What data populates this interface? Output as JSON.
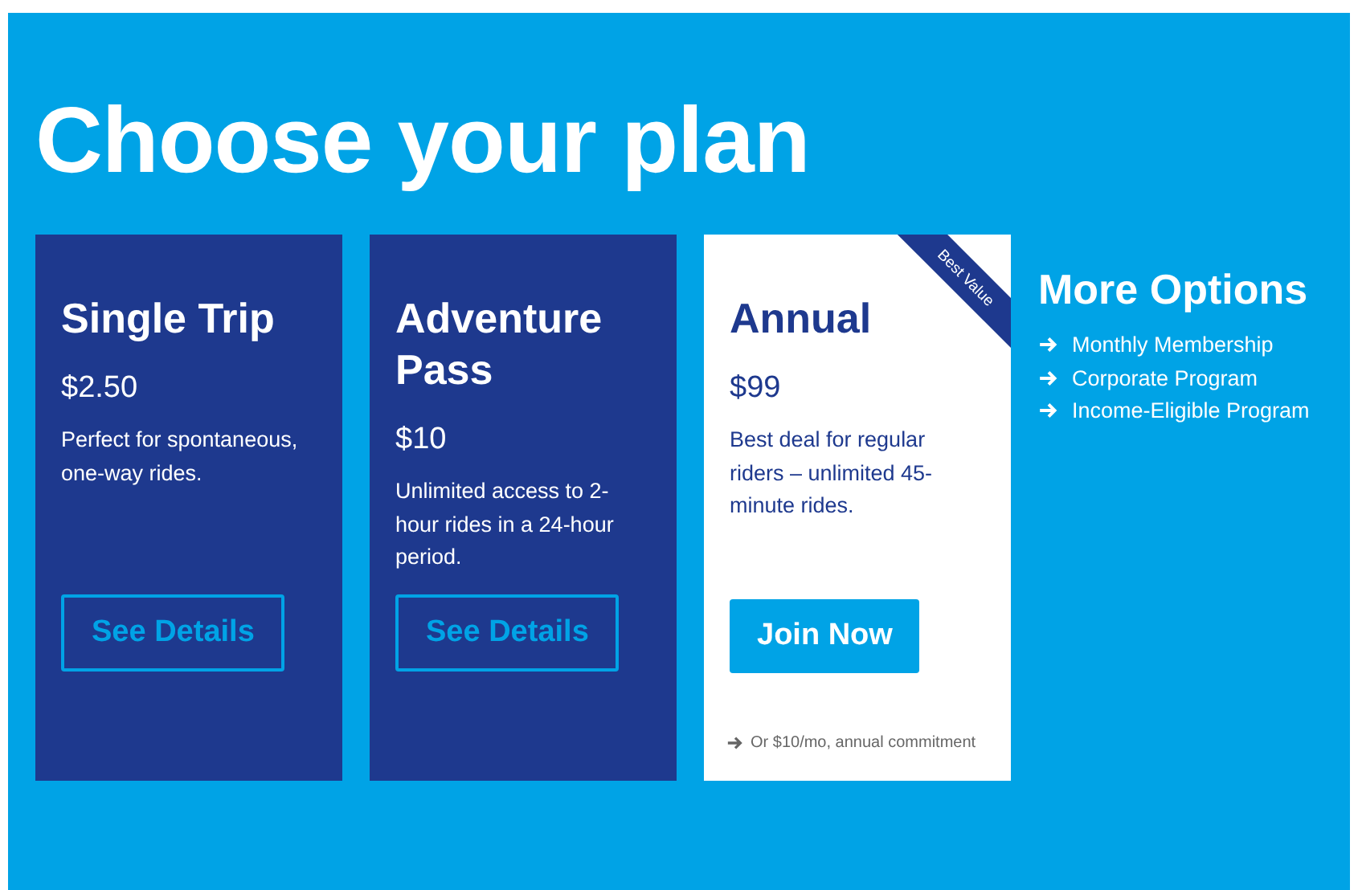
{
  "heading": "Choose your plan",
  "plans": [
    {
      "name": "Single Trip",
      "price": "$2.50",
      "description": "Perfect for spontaneous, one-way rides.",
      "featured": false,
      "button": "See Details"
    },
    {
      "name": "Adventure Pass",
      "price": "$10",
      "description": "Unlimited access to 2-hour rides in a 24-hour period.",
      "featured": false,
      "button": "See Details"
    },
    {
      "name": "Annual",
      "price": "$99",
      "description": "Best deal for regular riders – unlimited 45-minute rides.",
      "featured": true,
      "ribbon": "Best Value",
      "button": "Join Now",
      "note": "Or $10/mo, annual commitment"
    }
  ],
  "more_options": {
    "title": "More Options",
    "links": [
      "Monthly Membership",
      "Corporate Program",
      "Income-Eligible Program"
    ]
  }
}
